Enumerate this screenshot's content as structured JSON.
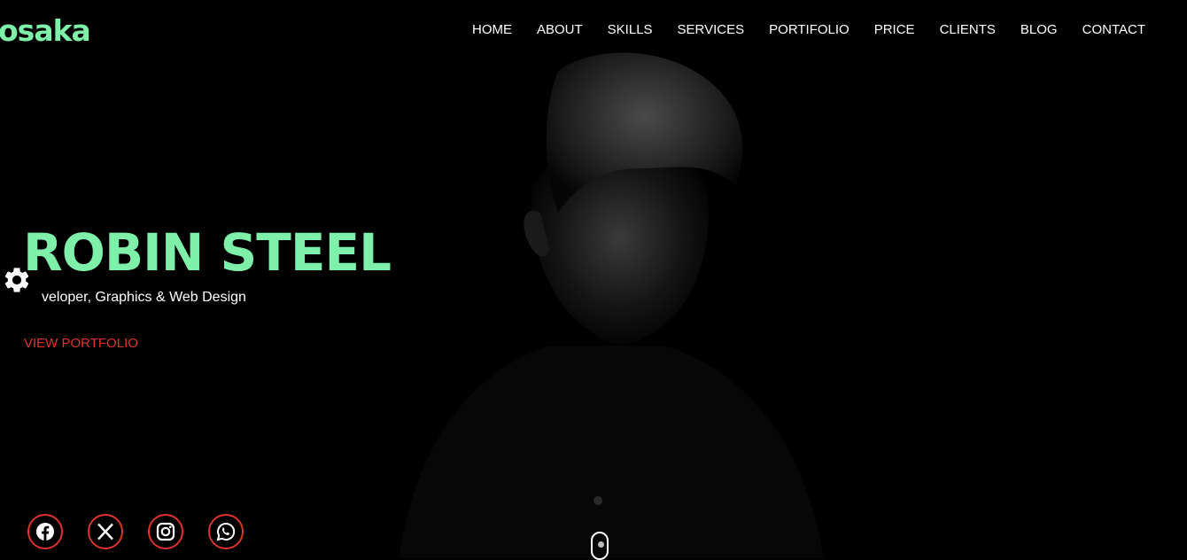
{
  "brand": {
    "logo": "osaka",
    "accent": "#7ef0a9"
  },
  "nav": {
    "items": [
      "HOME",
      "ABOUT",
      "SKILLS",
      "SERVICES",
      "PORTIFOLIO",
      "PRICE",
      "CLIENTS",
      "BLOG",
      "CONTACT"
    ]
  },
  "hero": {
    "name": "ROBIN STEEL",
    "subtitle": "veloper, Graphics & Web Design",
    "cta": "VIEW PORTFOLIO",
    "cta_color": "#e0322d"
  },
  "settings": {
    "icon": "gear-icon"
  },
  "socials": [
    "facebook-icon",
    "x-icon",
    "instagram-icon",
    "whatsapp-icon"
  ],
  "scroll": {
    "icon": "mouse-scroll-icon"
  }
}
